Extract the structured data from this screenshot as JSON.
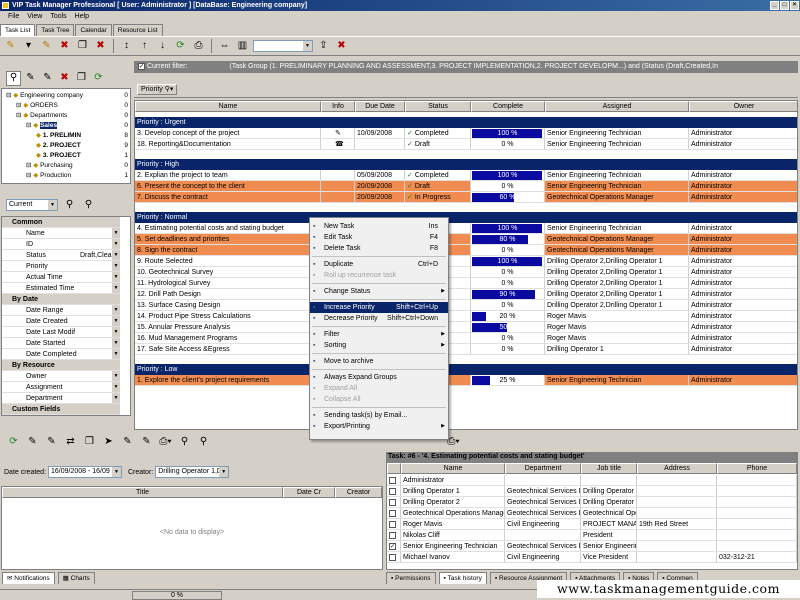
{
  "window": {
    "title": "VIP Task Manager Professional [ User: Administrator ] [DataBase: Engineering company]"
  },
  "menu": [
    "File",
    "View",
    "Tools",
    "Help"
  ],
  "tabs": [
    "Task List",
    "Task Tree",
    "Calendar",
    "Resource List"
  ],
  "tree": [
    {
      "label": "Engineering company",
      "count": "0",
      "level": 0,
      "bold": false
    },
    {
      "label": "ORDERS",
      "count": "0",
      "level": 1,
      "bold": false
    },
    {
      "label": "Departments",
      "count": "0",
      "level": 1,
      "bold": false
    },
    {
      "label": "Sales",
      "count": "0",
      "level": 2,
      "bold": true,
      "selected": true
    },
    {
      "label": "1. PRELIMIN",
      "count": "8",
      "level": 3,
      "bold": true
    },
    {
      "label": "2. PROJECT",
      "count": "9",
      "level": 3,
      "bold": true
    },
    {
      "label": "3. PROJECT",
      "count": "1",
      "level": 3,
      "bold": true
    },
    {
      "label": "Purchasing",
      "count": "0",
      "level": 2,
      "bold": false
    },
    {
      "label": "Production",
      "count": "1",
      "level": 2,
      "bold": false
    }
  ],
  "filter_panel": {
    "combo": "Current"
  },
  "properties": [
    {
      "type": "section",
      "label": "Common"
    },
    {
      "label": "Name",
      "value": ""
    },
    {
      "label": "ID",
      "value": ""
    },
    {
      "label": "Status",
      "value": "Draft,Clea"
    },
    {
      "label": "Priority",
      "value": ""
    },
    {
      "label": "Actual Time",
      "value": ""
    },
    {
      "label": "Estimated Time",
      "value": ""
    },
    {
      "type": "section",
      "label": "By Date"
    },
    {
      "label": "Date Range",
      "value": ""
    },
    {
      "label": "Date Created",
      "value": ""
    },
    {
      "label": "Date Last Modif",
      "value": ""
    },
    {
      "label": "Date Started",
      "value": ""
    },
    {
      "label": "Date Completed",
      "value": ""
    },
    {
      "type": "section",
      "label": "By Resource"
    },
    {
      "label": "Owner",
      "value": ""
    },
    {
      "label": "Assignment",
      "value": ""
    },
    {
      "label": "Department",
      "value": ""
    },
    {
      "type": "section",
      "label": "Custom Fields"
    }
  ],
  "current_filter": {
    "label": "Current filter:",
    "text": "(Task Group  (1. PRELIMINARY PLANNING AND ASSESSMENT,3. PROJECT IMPLEMENTATION,2. PROJECT DEVELOPM...) and (Status  (Draft,Created,In"
  },
  "group_by": "Priority",
  "grid_headers": [
    "Name",
    "Info",
    "Due Date",
    "Status",
    "Complete",
    "Assigned",
    "Owner"
  ],
  "groups": [
    {
      "title": "Priority : Urgent",
      "rows": [
        {
          "name": "3. Develop concept of the project",
          "due": "10/09/2008",
          "status": "Completed",
          "complete": "100 %",
          "pct": 100,
          "assigned": "Senior Engineering Technician",
          "owner": "Administrator",
          "orange": false
        },
        {
          "name": "18. Reporting&Documentation",
          "due": "",
          "status": "Draft",
          "complete": "0 %",
          "pct": 0,
          "assigned": "Senior Engineering Technician",
          "owner": "Administrator",
          "orange": false
        }
      ]
    },
    {
      "title": "Priority : High",
      "rows": [
        {
          "name": "2. Explian the project to team",
          "due": "05/09/2008",
          "status": "Completed",
          "complete": "100 %",
          "pct": 100,
          "assigned": "Senior Engineering Technician",
          "owner": "Administrator",
          "orange": false
        },
        {
          "name": "6. Present the concept to the client",
          "due": "20/09/2008",
          "status": "Draft",
          "complete": "0 %",
          "pct": 0,
          "assigned": "Senior Engineering Technician",
          "owner": "Administrator",
          "orange": true
        },
        {
          "name": "7. Discuss the contract",
          "due": "20/09/2008",
          "status": "In Progress",
          "complete": "60 %",
          "pct": 60,
          "assigned": "Geotechnical Operations Manager",
          "owner": "Administrator",
          "orange": true
        }
      ]
    },
    {
      "title": "Priority : Normal",
      "rows": [
        {
          "name": "4. Estimating potential costs and stating budget",
          "due": "",
          "status": "eted",
          "complete": "100 %",
          "pct": 100,
          "assigned": "Senior Engineering Technician",
          "owner": "Administrator",
          "orange": false
        },
        {
          "name": "5. Set deadlines and priorities",
          "due": "",
          "status": "gress",
          "complete": "80 %",
          "pct": 80,
          "assigned": "Geotechnical Operations Manager",
          "owner": "Administrator",
          "orange": true
        },
        {
          "name": "8. Sign the contract",
          "due": "",
          "status": "",
          "complete": "0 %",
          "pct": 0,
          "assigned": "Geotechnical Operations Manager",
          "owner": "Administrator",
          "orange": true
        },
        {
          "name": "9. Route Selected",
          "due": "",
          "status": "eted",
          "complete": "100 %",
          "pct": 100,
          "assigned": "Drilling Operator 2,Drilling Operator 1",
          "owner": "Administrator",
          "orange": false
        },
        {
          "name": "10. Geotechnical Survey",
          "due": "",
          "status": "ed",
          "complete": "0 %",
          "pct": 0,
          "assigned": "Drilling Operator 2,Drilling Operator 1",
          "owner": "Administrator",
          "orange": false
        },
        {
          "name": "11. Hydrological Survey",
          "due": "",
          "status": "ed",
          "complete": "0 %",
          "pct": 0,
          "assigned": "Drilling Operator 2,Drilling Operator 1",
          "owner": "Administrator",
          "orange": false
        },
        {
          "name": "12. Drill Path Design",
          "due": "",
          "status": "gress",
          "complete": "90 %",
          "pct": 90,
          "assigned": "Drilling Operator 2,Drilling Operator 1",
          "owner": "Administrator",
          "orange": false
        },
        {
          "name": "13. Surface Casing Design",
          "due": "",
          "status": "ed",
          "complete": "0 %",
          "pct": 0,
          "assigned": "Drilling Operator 2,Drilling Operator 1",
          "owner": "Administrator",
          "orange": false
        },
        {
          "name": "14. Product Pipe Stress Calculations",
          "due": "",
          "status": "gress",
          "complete": "20 %",
          "pct": 20,
          "assigned": "Roger Mavis",
          "owner": "Administrator",
          "orange": false
        },
        {
          "name": "15. Annular Pressure Analysis",
          "due": "",
          "status": "gress",
          "complete": "50 %",
          "pct": 50,
          "assigned": "Roger Mavis",
          "owner": "Administrator",
          "orange": false
        },
        {
          "name": "16. Mud Management Programs",
          "due": "",
          "status": "",
          "complete": "0 %",
          "pct": 0,
          "assigned": "Roger Mavis",
          "owner": "Administrator",
          "orange": false
        },
        {
          "name": "17. Safe Site Access &Egress",
          "due": "",
          "status": "",
          "complete": "0 %",
          "pct": 0,
          "assigned": "Drilling Operator 1",
          "owner": "Administrator",
          "orange": false
        }
      ]
    },
    {
      "title": "Priority : Low",
      "rows": [
        {
          "name": "1. Explore the client's project requirements",
          "due": "",
          "status": "gress",
          "complete": "25 %",
          "pct": 25,
          "assigned": "Senior Engineering Technician",
          "owner": "Administrator",
          "orange": true
        }
      ]
    }
  ],
  "context_menu": [
    {
      "label": "New Task",
      "shortcut": "Ins",
      "arrow": ""
    },
    {
      "label": "Edit Task",
      "shortcut": "F4",
      "arrow": ""
    },
    {
      "label": "Delete Task",
      "shortcut": "F8",
      "arrow": ""
    },
    {
      "sep": true
    },
    {
      "label": "Duplicate",
      "shortcut": "Ctrl+D",
      "arrow": ""
    },
    {
      "label": "Roll up recurrence task",
      "shortcut": "",
      "disabled": true,
      "arrow": ""
    },
    {
      "sep": true
    },
    {
      "label": "Change Status",
      "shortcut": "",
      "arrow": "▶"
    },
    {
      "sep": true
    },
    {
      "label": "Increase Priority",
      "shortcut": "Shift+Ctrl+Up",
      "selected": true,
      "arrow": ""
    },
    {
      "label": "Decrease Priority",
      "shortcut": "Shift+Ctrl+Down",
      "arrow": ""
    },
    {
      "sep": true
    },
    {
      "label": "Filter",
      "shortcut": "",
      "arrow": "▶"
    },
    {
      "label": "Sorting",
      "shortcut": "",
      "arrow": "▶"
    },
    {
      "sep": true
    },
    {
      "label": "Move to archive",
      "shortcut": "",
      "arrow": ""
    },
    {
      "sep": true
    },
    {
      "label": "Always Expand Groups",
      "shortcut": "",
      "arrow": ""
    },
    {
      "label": "Expand All",
      "shortcut": "",
      "disabled": true,
      "arrow": ""
    },
    {
      "label": "Collapse All",
      "shortcut": "",
      "disabled": true,
      "arrow": ""
    },
    {
      "sep": true
    },
    {
      "label": "Sending task(s) by Email...",
      "shortcut": "",
      "arrow": ""
    },
    {
      "label": "Export/Printing",
      "shortcut": "",
      "arrow": "▶"
    }
  ],
  "history": {
    "date_label": "Date created:",
    "date_value": "16/09/2008 - 16/09",
    "creator_label": "Creator:",
    "creator_value": "Drilling Operator 1,Dr",
    "headers": [
      "Title",
      "Date Cr",
      "Creator"
    ],
    "empty": "<No data to display>",
    "tabs": [
      "Notifications",
      "Charts"
    ]
  },
  "resources": {
    "title": "Task: #6 - '4. Estimating potential costs and stating budget'",
    "headers": [
      "",
      "Name",
      "Department",
      "Job title",
      "Address",
      "Phone"
    ],
    "rows": [
      {
        "checked": false,
        "name": "Administrator",
        "dept": "",
        "job": "",
        "addr": "",
        "phone": ""
      },
      {
        "checked": false,
        "name": "Drilling Operator 1",
        "dept": "Geotechnical Services D",
        "job": "Drilling Operator",
        "addr": "",
        "phone": ""
      },
      {
        "checked": false,
        "name": "Drilling Operator 2",
        "dept": "Geotechnical Services D",
        "job": "Drilling Operator",
        "addr": "",
        "phone": ""
      },
      {
        "checked": false,
        "name": "Geotechnical Operations Manage",
        "dept": "Geotechnical Services D",
        "job": "Geotechnical Ope",
        "addr": "",
        "phone": ""
      },
      {
        "checked": false,
        "name": "Roger Mavis",
        "dept": "Civil Engineering",
        "job": "PROJECT MANA(",
        "addr": "19th Red Street",
        "phone": ""
      },
      {
        "checked": false,
        "name": "Nikolas Cliff",
        "dept": "",
        "job": "President",
        "addr": "",
        "phone": ""
      },
      {
        "checked": true,
        "name": "Senior Engineering Technician",
        "dept": "Geotechnical Services D",
        "job": "Senior Engineering",
        "addr": "",
        "phone": ""
      },
      {
        "checked": false,
        "name": "Michael Ivanov",
        "dept": "Civil Engineering",
        "job": "Vice President",
        "addr": "",
        "phone": "032-312-21"
      }
    ],
    "tabs": [
      "Permissions",
      "Task history",
      "Resource Assignment",
      "Attachments",
      "Notes",
      "Commen"
    ]
  },
  "statusbar": {
    "progress": "0 %"
  },
  "watermark": "www.taskmanagementguide.com"
}
